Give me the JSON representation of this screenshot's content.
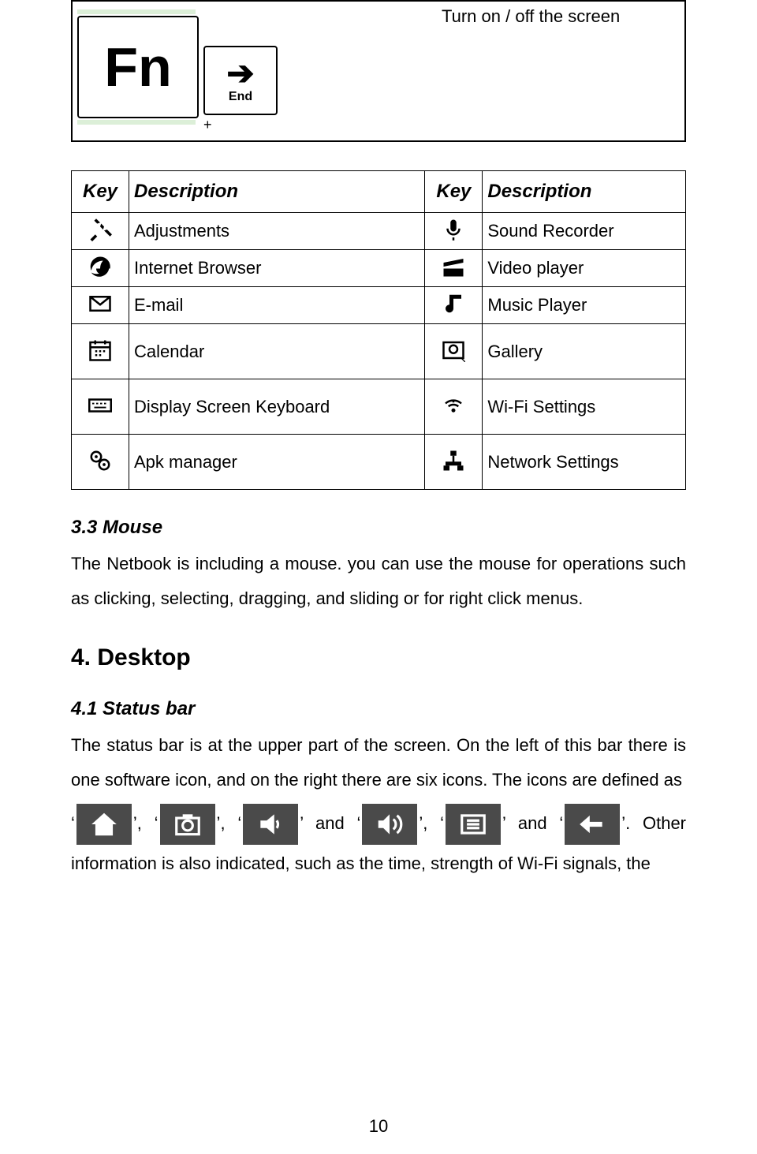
{
  "topbox": {
    "fn_label": "Fn",
    "end_label": "End",
    "plus": "+",
    "description": "Turn on / off the screen"
  },
  "table": {
    "headers": {
      "key": "Key",
      "desc": "Description"
    },
    "rows": [
      {
        "left": "Adjustments",
        "right": "Sound Recorder"
      },
      {
        "left": "Internet Browser",
        "right": "Video player"
      },
      {
        "left": "E-mail",
        "right": "Music Player"
      },
      {
        "left": "Calendar",
        "right": "Gallery"
      },
      {
        "left": "Display Screen Keyboard",
        "right": "Wi-Fi Settings"
      },
      {
        "left": "Apk manager",
        "right": "Network Settings"
      }
    ]
  },
  "sec_mouse": {
    "heading": "3.3    Mouse",
    "body": "The Netbook is including a mouse. you can use the mouse for operations such as clicking, selecting, dragging, and sliding or for right click menus."
  },
  "chap_desktop": {
    "heading": "4.    Desktop"
  },
  "sec_status": {
    "heading": "4.1    Status bar",
    "body": "The status bar is at the upper part of the screen. On the left of this bar there is one software icon, and on the right there are six icons. The icons are defined as"
  },
  "iconline": {
    "q": "‘",
    "qq": "’",
    "c1": ", ",
    "c2": ", ",
    "and1": " and ",
    "c3": ", ",
    "and2": " and ",
    "tail": ". Other information is also indicated, such as the time, strength of Wi-Fi signals, the"
  },
  "page_number": "10"
}
